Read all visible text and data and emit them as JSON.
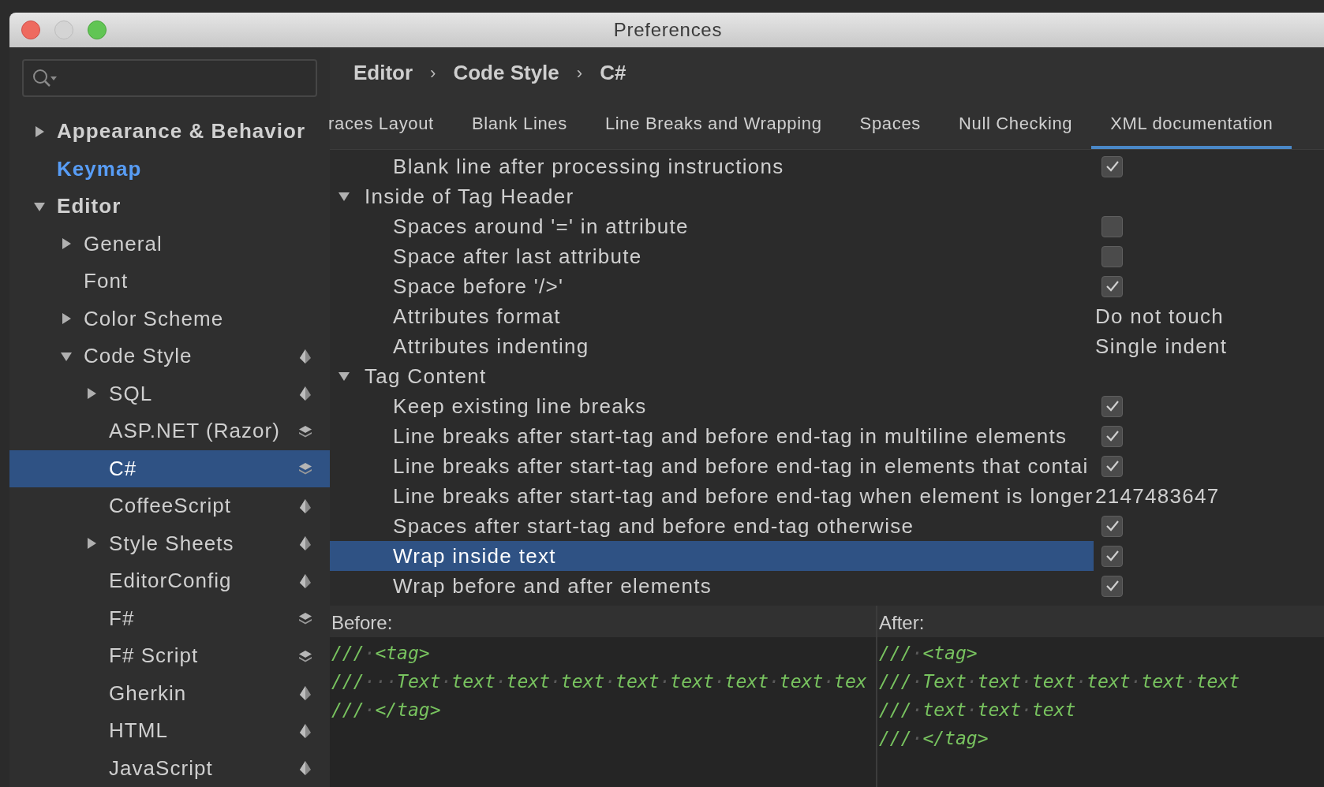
{
  "window": {
    "title": "Preferences"
  },
  "sidebar": {
    "items": [
      {
        "label": "Appearance & Behavior",
        "kind": "section",
        "expanded": false,
        "selected": false
      },
      {
        "label": "Keymap",
        "kind": "link",
        "selected": false
      },
      {
        "label": "Editor",
        "kind": "section",
        "expanded": true,
        "selected": false,
        "children": [
          {
            "label": "General",
            "expanded": false,
            "selected": false
          },
          {
            "label": "Font",
            "selected": false
          },
          {
            "label": "Color Scheme",
            "expanded": false,
            "selected": false
          },
          {
            "label": "Code Style",
            "expanded": true,
            "selected": false,
            "project_scheme": false,
            "children": [
              {
                "label": "SQL",
                "expanded": false,
                "selected": false,
                "project_scheme": false
              },
              {
                "label": "ASP.NET (Razor)",
                "selected": false,
                "project_scheme": true
              },
              {
                "label": "C#",
                "selected": true,
                "project_scheme": true
              },
              {
                "label": "CoffeeScript",
                "selected": false,
                "project_scheme": false
              },
              {
                "label": "Style Sheets",
                "expanded": false,
                "selected": false,
                "project_scheme": false
              },
              {
                "label": "EditorConfig",
                "selected": false,
                "project_scheme": false
              },
              {
                "label": "F#",
                "selected": false,
                "project_scheme": true
              },
              {
                "label": "F# Script",
                "selected": false,
                "project_scheme": true
              },
              {
                "label": "Gherkin",
                "selected": false,
                "project_scheme": false
              },
              {
                "label": "HTML",
                "selected": false,
                "project_scheme": false
              },
              {
                "label": "JavaScript",
                "selected": false,
                "project_scheme": false
              }
            ]
          }
        ]
      }
    ]
  },
  "breadcrumb": [
    "Editor",
    "Code Style",
    "C#"
  ],
  "breadcrumb_separator": "›",
  "tabs": [
    {
      "label": "races Layout",
      "selected": false
    },
    {
      "label": "Blank Lines",
      "selected": false
    },
    {
      "label": "Line Breaks and Wrapping",
      "selected": false
    },
    {
      "label": "Spaces",
      "selected": false
    },
    {
      "label": "Null Checking",
      "selected": false
    },
    {
      "label": "XML documentation",
      "selected": true
    }
  ],
  "settings": [
    {
      "kind": "checkbox",
      "label": "Blank line after processing instructions",
      "checked": true,
      "selected": false
    },
    {
      "kind": "group",
      "label": "Inside of Tag Header",
      "expanded": true
    },
    {
      "kind": "checkbox",
      "label": "Spaces around '=' in attribute",
      "checked": false,
      "selected": false
    },
    {
      "kind": "checkbox",
      "label": "Space after last attribute",
      "checked": false,
      "selected": false
    },
    {
      "kind": "checkbox",
      "label": "Space before '/>'",
      "checked": true,
      "selected": false
    },
    {
      "kind": "value",
      "label": "Attributes format",
      "value": "Do not touch",
      "selected": false
    },
    {
      "kind": "value",
      "label": "Attributes indenting",
      "value": "Single indent",
      "selected": false
    },
    {
      "kind": "group",
      "label": "Tag Content",
      "expanded": true
    },
    {
      "kind": "checkbox",
      "label": "Keep existing line breaks",
      "checked": true,
      "selected": false
    },
    {
      "kind": "checkbox",
      "label": "Line breaks after start-tag and before end-tag in multiline elements",
      "checked": true,
      "selected": false
    },
    {
      "kind": "checkbox",
      "label": "Line breaks after start-tag and before end-tag in elements that contai",
      "checked": true,
      "selected": false
    },
    {
      "kind": "value",
      "label": "Line breaks after start-tag and before end-tag when element is longer",
      "value": "2147483647",
      "selected": false
    },
    {
      "kind": "checkbox",
      "label": "Spaces after start-tag and before end-tag otherwise",
      "checked": true,
      "selected": false
    },
    {
      "kind": "checkbox",
      "label": "Wrap inside text",
      "checked": true,
      "selected": true
    },
    {
      "kind": "checkbox",
      "label": "Wrap before and after elements",
      "checked": true,
      "selected": false
    }
  ],
  "preview": [
    {
      "label": "Before:",
      "lines": [
        "///·<tag>",
        "///···Text·text·text·text·text·text·text·text·tex",
        "///·</tag>"
      ]
    },
    {
      "label": "After:",
      "lines": [
        "///·<tag>",
        "///·Text·text·text·text·text·text",
        "///·text·text·text",
        "///·</tag>"
      ]
    }
  ]
}
